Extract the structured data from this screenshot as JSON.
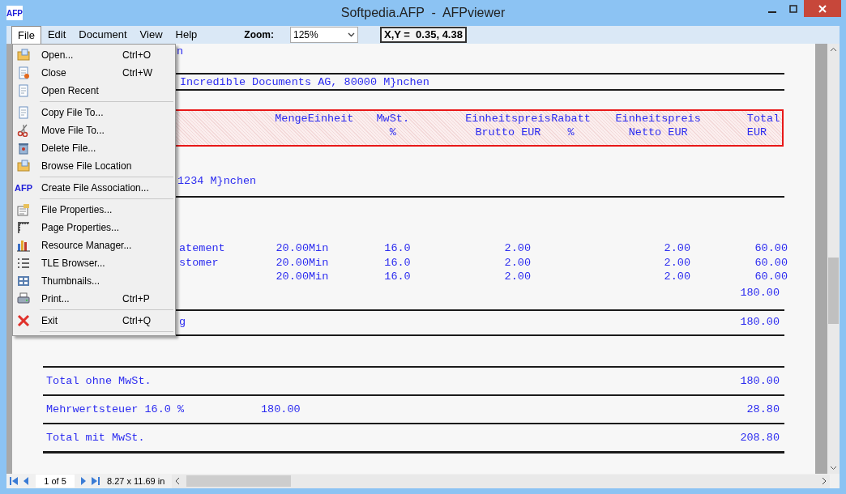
{
  "window": {
    "title": "Softpedia.AFP  -  AFPviewer",
    "app_logo": "AFP"
  },
  "menu_bar": [
    {
      "label": "File",
      "selected": true
    },
    {
      "label": "Edit",
      "selected": false
    },
    {
      "label": "Document",
      "selected": false
    },
    {
      "label": "View",
      "selected": false
    },
    {
      "label": "Help",
      "selected": false
    }
  ],
  "zoom": {
    "label": "Zoom:",
    "value": "125%"
  },
  "coordinates": "X,Y =  0.35, 4.38",
  "file_menu": [
    {
      "kind": "item",
      "label": "Open...",
      "shortcut": "Ctrl+O"
    },
    {
      "kind": "item",
      "label": "Close",
      "shortcut": "Ctrl+W"
    },
    {
      "kind": "item",
      "label": "Open Recent"
    },
    {
      "kind": "separator"
    },
    {
      "kind": "item",
      "label": "Copy File To..."
    },
    {
      "kind": "item",
      "label": "Move File To..."
    },
    {
      "kind": "item",
      "label": "Delete File..."
    },
    {
      "kind": "item",
      "label": "Browse File Location"
    },
    {
      "kind": "separator"
    },
    {
      "kind": "item",
      "label": "Create File Association...",
      "icon_text": "AFP"
    },
    {
      "kind": "separator"
    },
    {
      "kind": "item",
      "label": "File Properties..."
    },
    {
      "kind": "item",
      "label": "Page Properties..."
    },
    {
      "kind": "item",
      "label": "Resource Manager..."
    },
    {
      "kind": "item",
      "label": "TLE Browser..."
    },
    {
      "kind": "item",
      "label": "Thumbnails..."
    },
    {
      "kind": "item",
      "label": "Print...",
      "shortcut": "Ctrl+P"
    },
    {
      "kind": "separator"
    },
    {
      "kind": "item",
      "label": "Exit",
      "shortcut": "Ctrl+Q"
    },
    {
      "kind": "separator"
    }
  ],
  "document": {
    "line_1": "n",
    "sender": "Incredible Documents AG, 80000 M}nchen",
    "header_columns": [
      {
        "lines": [
          "Menge"
        ]
      },
      {
        "lines": [
          "Einheit"
        ]
      },
      {
        "lines": [
          "MwSt.",
          "%"
        ]
      },
      {
        "lines": [
          "Einheitspreis",
          "Brutto EUR"
        ]
      },
      {
        "lines": [
          "Rabatt",
          "%"
        ]
      },
      {
        "lines": [
          "Einheitspreis",
          "Netto EUR"
        ]
      },
      {
        "lines": [
          "Total",
          "EUR"
        ]
      }
    ],
    "address": "1234 M}nchen",
    "rows": [
      {
        "label": "atement",
        "quantity": "20.00",
        "unit": "Min",
        "vat": "16.0",
        "gross_price": "2.00",
        "net_price": "2.00",
        "total": "60.00"
      },
      {
        "label": "stomer",
        "quantity": "20.00",
        "unit": "Min",
        "vat": "16.0",
        "gross_price": "2.00",
        "net_price": "2.00",
        "total": "60.00"
      },
      {
        "quantity": "20.00",
        "unit": "Min",
        "vat": "16.0",
        "gross_price": "2.00",
        "net_price": "2.00",
        "total": "60.00"
      }
    ],
    "subtotal": "180.00",
    "sum_row": {
      "label": "g",
      "value": "180.00"
    },
    "totals": [
      {
        "label": "Total ohne MwSt.",
        "value": "180.00"
      },
      {
        "label": "Mehrwertsteuer 16.0 %",
        "base": "180.00",
        "value": "28.80"
      },
      {
        "label": "Total mit MwSt.",
        "value": "208.80"
      }
    ]
  },
  "status_bar": {
    "page": "1 of 5",
    "page_size": "8.27 x 11.69 in"
  }
}
